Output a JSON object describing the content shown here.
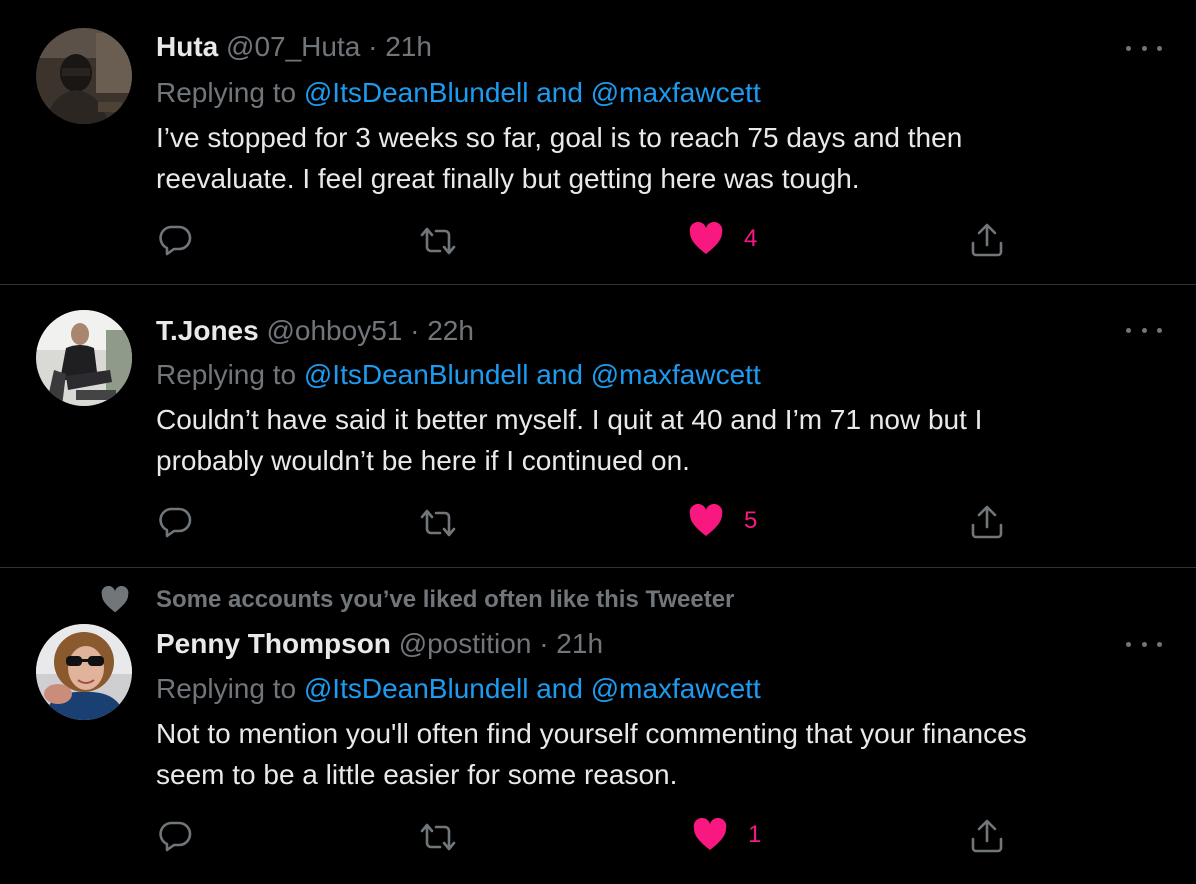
{
  "colors": {
    "background": "#000000",
    "text": "#e7e9ea",
    "muted": "#71767b",
    "mention": "#1d9bf0",
    "like": "#f91880",
    "divider": "#2f3336"
  },
  "tweets": [
    {
      "name": "Huta",
      "handle": "@07_Huta",
      "separator": "·",
      "time": "21h",
      "replying_prefix": "Replying to",
      "replying_to": "@ItsDeanBlundell and @maxfawcett",
      "body_line1": "I’ve stopped for 3 weeks so far, goal is to reach 75 days and then",
      "body_line2": "reevaluate. I feel great finally but getting here was tough.",
      "likes": "4",
      "liked": true
    },
    {
      "name": "T.Jones",
      "handle": "@ohboy51",
      "separator": "·",
      "time": "22h",
      "replying_prefix": "Replying to",
      "replying_to": "@ItsDeanBlundell and @maxfawcett",
      "body_line1": "Couldn’t have said it better myself. I quit at 40 and I’m 71 now but I",
      "body_line2": "probably wouldn’t be here if I continued on.",
      "likes": "5",
      "liked": true
    },
    {
      "social_context": "Some accounts you’ve liked often like this Tweeter",
      "name": "Penny Thompson",
      "handle": "@postition",
      "separator": "·",
      "time": "21h",
      "replying_prefix": "Replying to",
      "replying_to": "@ItsDeanBlundell and @maxfawcett",
      "body_line1": "Not to mention you'll often find yourself commenting that your finances",
      "body_line2": "seem to be a little easier for some reason.",
      "likes": "1",
      "liked": true
    }
  ],
  "icons": {
    "reply": "reply-icon",
    "retweet": "retweet-icon",
    "like": "heart-icon",
    "share": "share-icon",
    "more": "more-icon",
    "social_context": "heart-icon"
  }
}
